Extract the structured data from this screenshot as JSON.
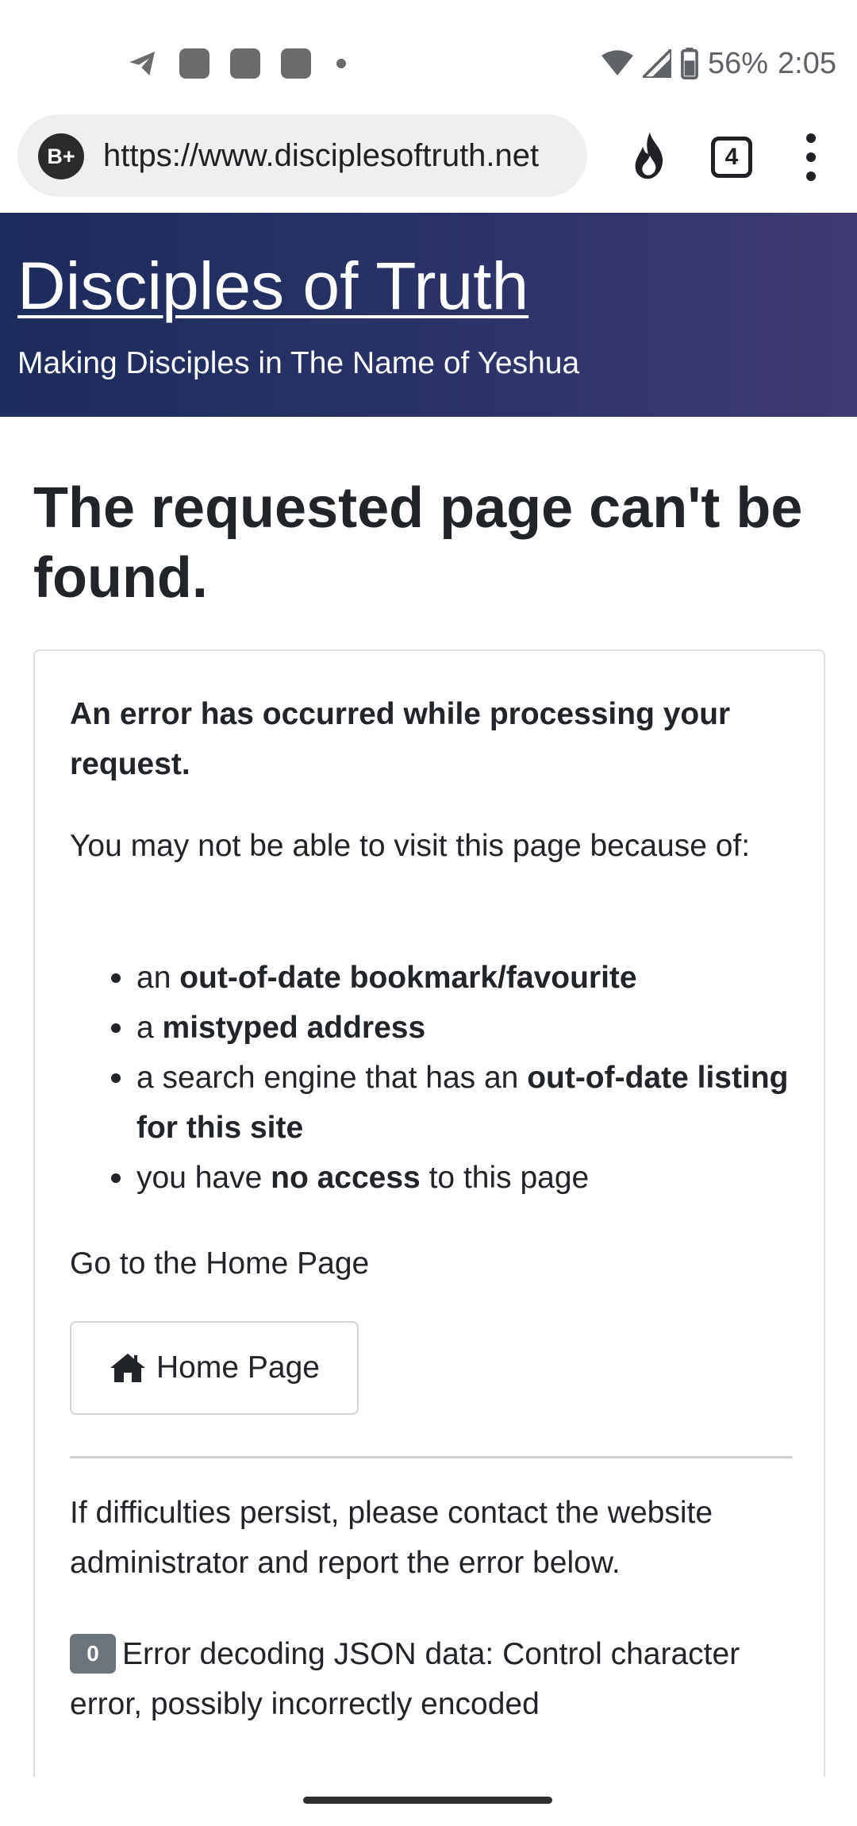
{
  "status_bar": {
    "battery": "56%",
    "time": "2:05"
  },
  "browser": {
    "site_badge": "B+",
    "url": "https://www.disciplesoftruth.net",
    "tab_count": "4"
  },
  "site": {
    "title": "Disciples of Truth",
    "tagline": "Making Disciples in The Name of Yeshua"
  },
  "main": {
    "heading": "The requested page can't be found.",
    "error_title": "An error has occurred while processing your request.",
    "reason_intro": "You may not be able to visit this page because of:",
    "reasons": [
      {
        "before": "an ",
        "bold": "out-of-date bookmark/favourite",
        "after": ""
      },
      {
        "before": "a ",
        "bold": "mistyped address",
        "after": ""
      },
      {
        "before": "a search engine that has an ",
        "bold": "out-of-date listing for this site",
        "after": ""
      },
      {
        "before": "you have ",
        "bold": "no access",
        "after": " to this page"
      }
    ],
    "goto_text": "Go to the Home Page",
    "home_button_label": "Home Page",
    "contact_text": "If difficulties persist, please contact the website administrator and report the error below.",
    "error_code": "0",
    "error_message": "Error decoding JSON data: Control character error, possibly incorrectly encoded"
  },
  "icons": {
    "status_left": [
      "telegram-icon",
      "notification-icon",
      "notification-icon",
      "notification-icon",
      "more-dot-icon"
    ],
    "status_right": [
      "wifi-icon",
      "signal-icon",
      "battery-icon"
    ],
    "toolbar": [
      "fire-icon",
      "tab-switcher-icon",
      "overflow-menu-icon"
    ],
    "home_button": "home-icon"
  },
  "colors": {
    "header_gradient_start": "#1c2c5c",
    "header_gradient_end": "#403b72",
    "badge": "#6c757d"
  }
}
